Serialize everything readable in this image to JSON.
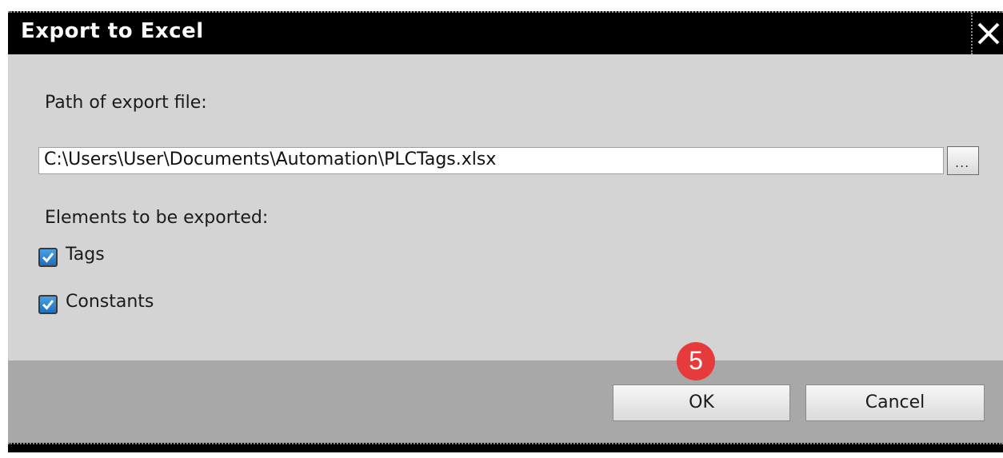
{
  "dialog": {
    "title": "Export to Excel",
    "close_icon": "close-icon"
  },
  "form": {
    "path_label": "Path of export file:",
    "path_value": "C:\\Users\\User\\Documents\\Automation\\PLCTags.xlsx",
    "browse_label": "...",
    "elements_label": "Elements to be exported:",
    "options": [
      {
        "label": "Tags",
        "checked": true
      },
      {
        "label": "Constants",
        "checked": true
      }
    ]
  },
  "buttons": {
    "ok_label": "OK",
    "cancel_label": "Cancel"
  },
  "annotation": {
    "step_number": "5",
    "badge_color": "#e53b3b"
  },
  "colors": {
    "title_bar": "#000000",
    "content_bg": "#d4d4d4",
    "footer_bg": "#a8a8a8",
    "checkbox_fill": "#1f6fc0"
  }
}
